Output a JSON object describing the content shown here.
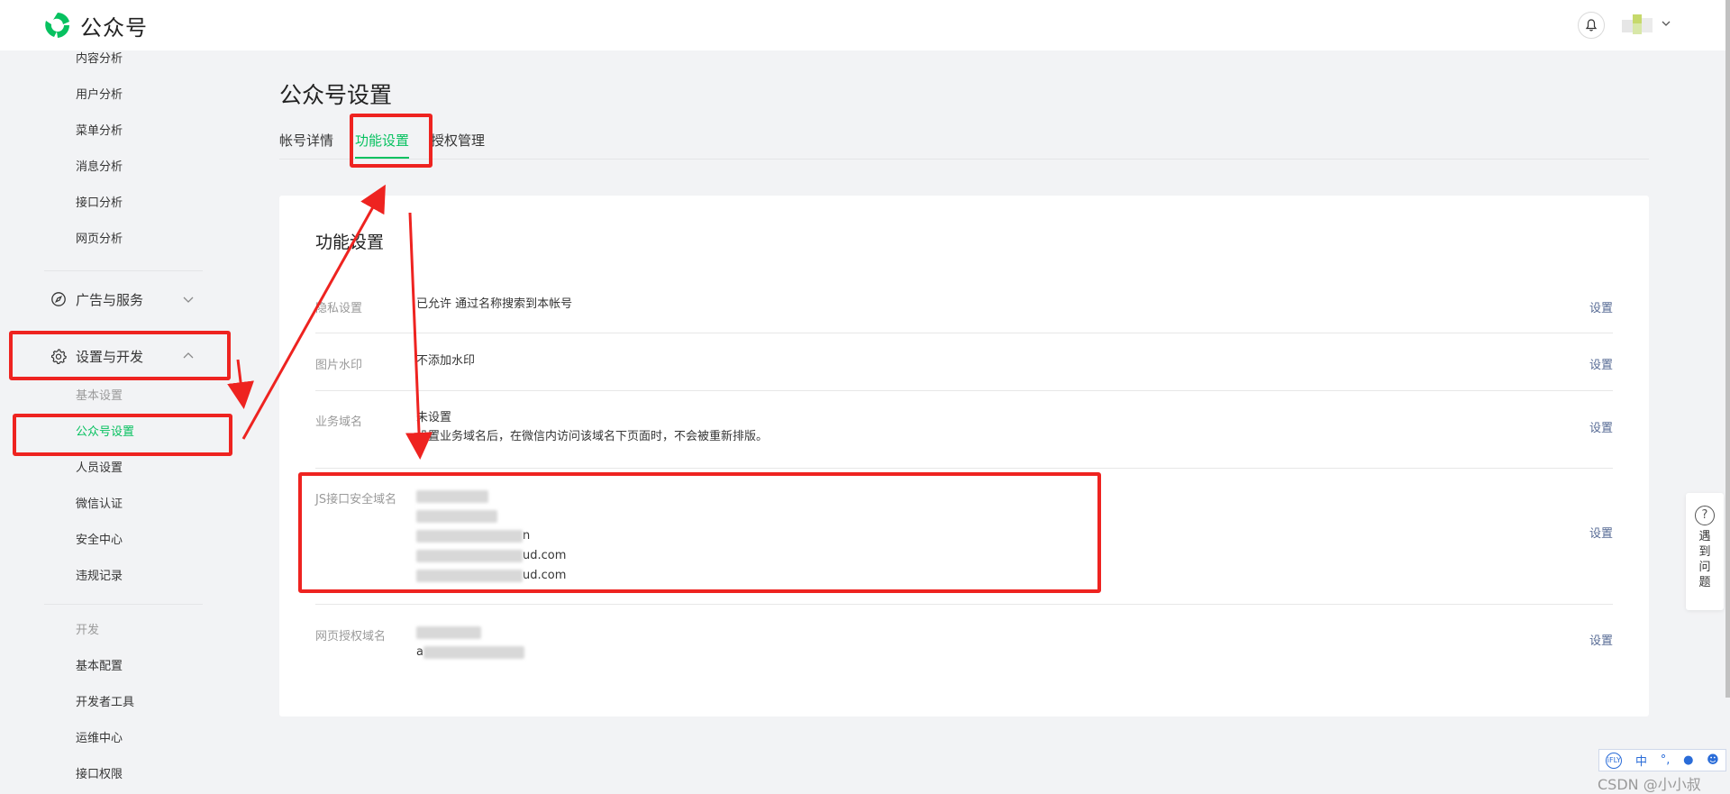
{
  "header": {
    "app_name": "公众号",
    "brand_color": "#07c160",
    "bell_icon": "bell-icon",
    "avatar": "blurred user avatar"
  },
  "sidebar": {
    "analytics_items": [
      "内容分析",
      "用户分析",
      "菜单分析",
      "消息分析",
      "接口分析",
      "网页分析"
    ],
    "ads_group": {
      "label": "广告与服务",
      "icon": "compass-icon",
      "expanded": false
    },
    "settings_group": {
      "label": "设置与开发",
      "icon": "gear-icon",
      "expanded": true
    },
    "basic_header": "基本设置",
    "settings_items": [
      "公众号设置",
      "人员设置",
      "微信认证",
      "安全中心",
      "违规记录"
    ],
    "active_item": "公众号设置",
    "dev_header": "开发",
    "dev_items": [
      "基本配置",
      "开发者工具",
      "运维中心",
      "接口权限"
    ]
  },
  "main": {
    "page_title": "公众号设置",
    "tabs": [
      {
        "label": "帐号详情",
        "active": false
      },
      {
        "label": "功能设置",
        "active": true
      },
      {
        "label": "授权管理",
        "active": false
      }
    ]
  },
  "card": {
    "title": "功能设置",
    "action_label": "设置",
    "rows": [
      {
        "label": "隐私设置",
        "value_lines": [
          "已允许 通过名称搜索到本帐号"
        ]
      },
      {
        "label": "图片水印",
        "value_lines": [
          "不添加水印"
        ]
      },
      {
        "label": "业务域名",
        "value_lines": [
          "未设置",
          "设置业务域名后，在微信内访问该域名下页面时，不会被重新排版。"
        ]
      },
      {
        "label": "JS接口安全域名",
        "value_lines": [
          "",
          "",
          "n",
          "ud.com",
          "ud.com"
        ]
      },
      {
        "label": "网页授权域名",
        "value_lines": [
          "",
          "a"
        ]
      }
    ]
  },
  "helper": {
    "icon": "question-icon",
    "text": "遇到问题"
  },
  "ime_toolbar": {
    "items": [
      "iFLY",
      "中",
      "°,",
      "mic",
      "user"
    ]
  },
  "watermark": "CSDN @小小叔",
  "annotation_color": "#ee2320"
}
